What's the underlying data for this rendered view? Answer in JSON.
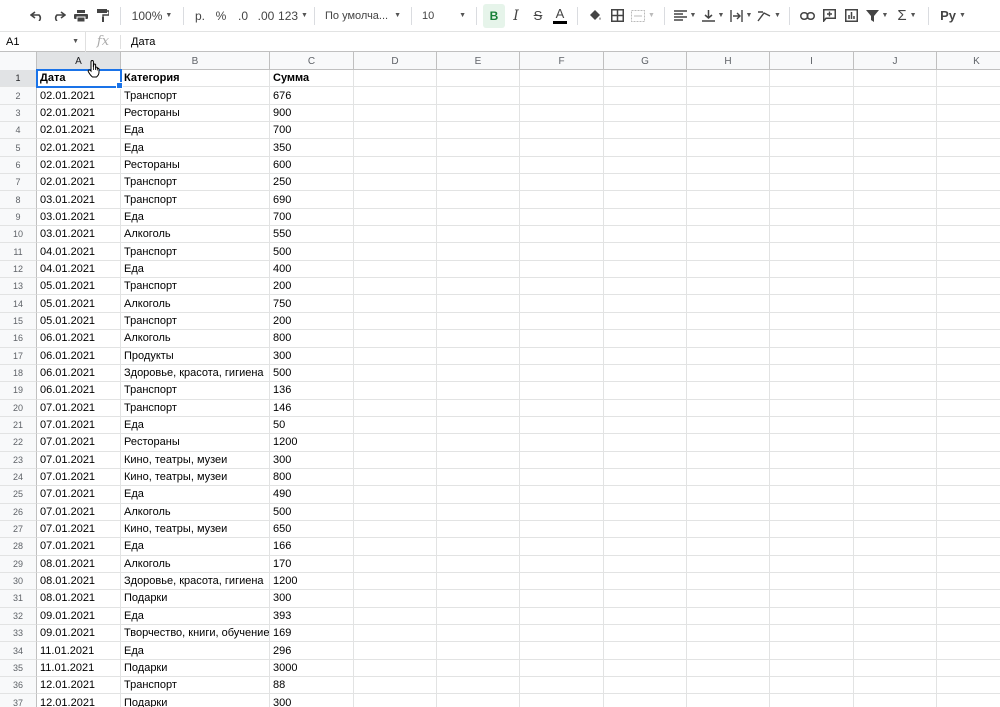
{
  "toolbar": {
    "zoom": "100%",
    "currency": "р.",
    "percent": "%",
    "dec_decrease": ".0",
    "dec_increase": ".00",
    "format_more": "123",
    "font": "По умолча...",
    "font_size": "10",
    "bold": "B",
    "italic": "I",
    "strike": "S",
    "text_color": "A",
    "input_tools": "Ру"
  },
  "formula_bar": {
    "cell_ref": "A1",
    "fx": "fx",
    "content": "Дата"
  },
  "columns": [
    "A",
    "B",
    "C",
    "D",
    "E",
    "F",
    "G",
    "H",
    "I",
    "J",
    "K"
  ],
  "rows": [
    {
      "n": "1",
      "a": "Дата",
      "b": "Категория",
      "c": "Сумма"
    },
    {
      "n": "2",
      "a": "02.01.2021",
      "b": "Транспорт",
      "c": "676"
    },
    {
      "n": "3",
      "a": "02.01.2021",
      "b": "Рестораны",
      "c": "900"
    },
    {
      "n": "4",
      "a": "02.01.2021",
      "b": "Еда",
      "c": "700"
    },
    {
      "n": "5",
      "a": "02.01.2021",
      "b": "Еда",
      "c": "350"
    },
    {
      "n": "6",
      "a": "02.01.2021",
      "b": "Рестораны",
      "c": "600"
    },
    {
      "n": "7",
      "a": "02.01.2021",
      "b": "Транспорт",
      "c": "250"
    },
    {
      "n": "8",
      "a": "03.01.2021",
      "b": "Транспорт",
      "c": "690"
    },
    {
      "n": "9",
      "a": "03.01.2021",
      "b": "Еда",
      "c": "700"
    },
    {
      "n": "10",
      "a": "03.01.2021",
      "b": "Алкоголь",
      "c": "550"
    },
    {
      "n": "11",
      "a": "04.01.2021",
      "b": "Транспорт",
      "c": "500"
    },
    {
      "n": "12",
      "a": "04.01.2021",
      "b": "Еда",
      "c": "400"
    },
    {
      "n": "13",
      "a": "05.01.2021",
      "b": "Транспорт",
      "c": "200"
    },
    {
      "n": "14",
      "a": "05.01.2021",
      "b": "Алкоголь",
      "c": "750"
    },
    {
      "n": "15",
      "a": "05.01.2021",
      "b": "Транспорт",
      "c": "200"
    },
    {
      "n": "16",
      "a": "06.01.2021",
      "b": "Алкоголь",
      "c": "800"
    },
    {
      "n": "17",
      "a": "06.01.2021",
      "b": "Продукты",
      "c": "300"
    },
    {
      "n": "18",
      "a": "06.01.2021",
      "b": "Здоровье, красота, гигиена",
      "c": "500"
    },
    {
      "n": "19",
      "a": "06.01.2021",
      "b": "Транспорт",
      "c": "136"
    },
    {
      "n": "20",
      "a": "07.01.2021",
      "b": "Транспорт",
      "c": "146"
    },
    {
      "n": "21",
      "a": "07.01.2021",
      "b": "Еда",
      "c": "50"
    },
    {
      "n": "22",
      "a": "07.01.2021",
      "b": "Рестораны",
      "c": "1200"
    },
    {
      "n": "23",
      "a": "07.01.2021",
      "b": "Кино, театры, музеи",
      "c": "300"
    },
    {
      "n": "24",
      "a": "07.01.2021",
      "b": "Кино, театры, музеи",
      "c": "800"
    },
    {
      "n": "25",
      "a": "07.01.2021",
      "b": "Еда",
      "c": "490"
    },
    {
      "n": "26",
      "a": "07.01.2021",
      "b": "Алкоголь",
      "c": "500"
    },
    {
      "n": "27",
      "a": "07.01.2021",
      "b": "Кино, театры, музеи",
      "c": "650"
    },
    {
      "n": "28",
      "a": "07.01.2021",
      "b": "Еда",
      "c": "166"
    },
    {
      "n": "29",
      "a": "08.01.2021",
      "b": "Алкоголь",
      "c": "170"
    },
    {
      "n": "30",
      "a": "08.01.2021",
      "b": "Здоровье, красота, гигиена",
      "c": "1200"
    },
    {
      "n": "31",
      "a": "08.01.2021",
      "b": "Подарки",
      "c": "300"
    },
    {
      "n": "32",
      "a": "09.01.2021",
      "b": "Еда",
      "c": "393"
    },
    {
      "n": "33",
      "a": "09.01.2021",
      "b": "Творчество, книги, обучение",
      "c": "169"
    },
    {
      "n": "34",
      "a": "11.01.2021",
      "b": "Еда",
      "c": "296"
    },
    {
      "n": "35",
      "a": "11.01.2021",
      "b": "Подарки",
      "c": "3000"
    },
    {
      "n": "36",
      "a": "12.01.2021",
      "b": "Транспорт",
      "c": "88"
    },
    {
      "n": "37",
      "a": "12.01.2021",
      "b": "Подарки",
      "c": "300"
    }
  ]
}
